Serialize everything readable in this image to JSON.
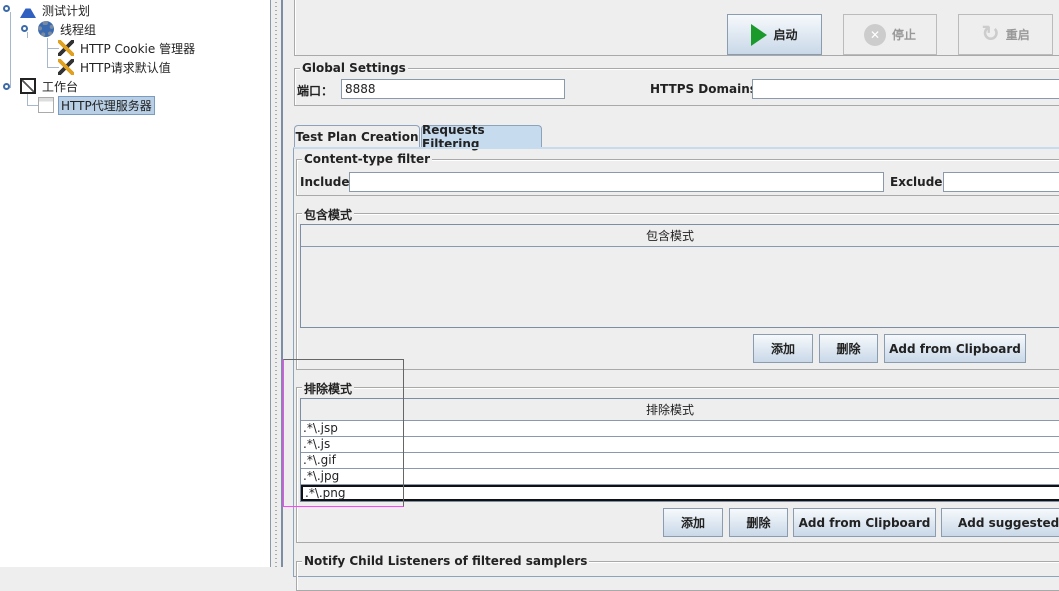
{
  "tree": {
    "items": [
      {
        "label": "测试计划",
        "icon": "flask-icon"
      },
      {
        "label": "线程组",
        "icon": "gear-icon"
      },
      {
        "label": "HTTP Cookie 管理器",
        "icon": "wrench-icon"
      },
      {
        "label": "HTTP请求默认值",
        "icon": "wrench-icon"
      },
      {
        "label": "工作台",
        "icon": "notebook-icon"
      },
      {
        "label": "HTTP代理服务器",
        "icon": "proxy-icon",
        "selected": true
      }
    ]
  },
  "controls": {
    "start": "启动",
    "stop": "停止",
    "restart": "重启"
  },
  "global": {
    "legend": "Global Settings",
    "port_label": "端口：",
    "port_value": "8888",
    "https_label": "HTTPS Domains :",
    "https_value": ""
  },
  "tabs": [
    {
      "label": "Test Plan Creation"
    },
    {
      "label": "Requests Filtering",
      "active": true
    }
  ],
  "content_filter": {
    "legend": "Content-type filter",
    "include_label": "Include:",
    "include_value": "",
    "exclude_label": "Exclude:",
    "exclude_value": ""
  },
  "include_patterns": {
    "legend": "包含模式",
    "header": "包含模式",
    "rows": [],
    "buttons": {
      "add": "添加",
      "delete": "删除",
      "clipboard": "Add from Clipboard"
    }
  },
  "exclude_patterns": {
    "legend": "排除模式",
    "header": "排除模式",
    "rows": [
      ".*\\.jsp",
      ".*\\.js",
      ".*\\.gif",
      ".*\\.jpg",
      ".*\\.png"
    ],
    "buttons": {
      "add": "添加",
      "delete": "删除",
      "clipboard": "Add from Clipboard",
      "suggested": "Add suggested Ex"
    }
  },
  "notify": {
    "legend": "Notify Child Listeners of filtered samplers"
  },
  "colors": {
    "highlight": "#ff44ff",
    "tab_active": "#c7dbef"
  }
}
